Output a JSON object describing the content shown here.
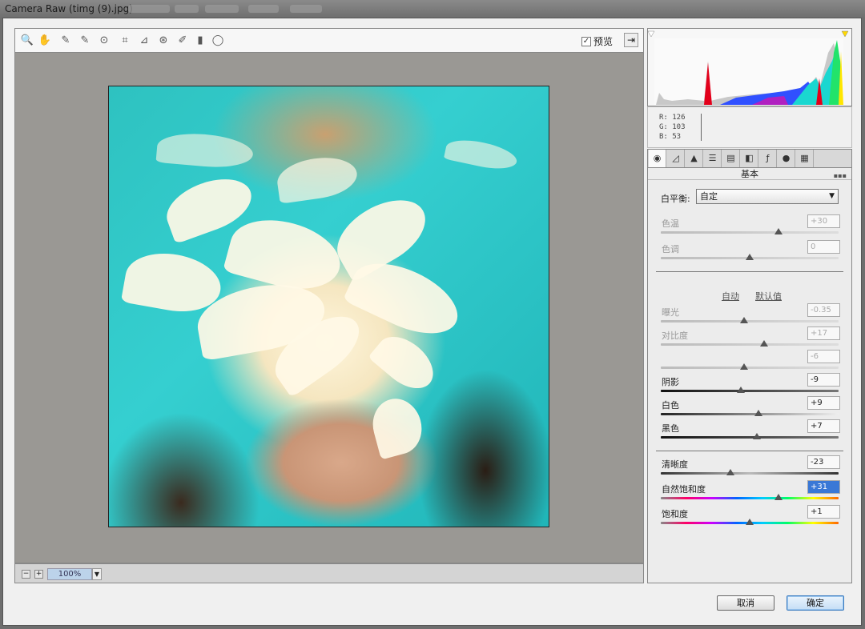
{
  "window": {
    "title": "Camera Raw (timg (9).jpg)"
  },
  "toolbar": {
    "tools": [
      {
        "name": "zoom-tool-icon",
        "glyph": "🔍"
      },
      {
        "name": "hand-tool-icon",
        "glyph": "✋"
      },
      {
        "name": "white-balance-tool-icon",
        "glyph": "✎"
      },
      {
        "name": "color-sampler-tool-icon",
        "glyph": "✎"
      },
      {
        "name": "targeted-adjustment-tool-icon",
        "glyph": "⊙"
      },
      {
        "name": "crop-tool-icon",
        "glyph": "⌗"
      },
      {
        "name": "straighten-tool-icon",
        "glyph": "⊿"
      },
      {
        "name": "spot-removal-tool-icon",
        "glyph": "⊛"
      },
      {
        "name": "adjustment-brush-icon",
        "glyph": "✐"
      },
      {
        "name": "graduated-filter-icon",
        "glyph": "▮"
      },
      {
        "name": "radial-filter-icon",
        "glyph": "◯"
      }
    ],
    "preview_label": "预览",
    "preview_checked": "✓"
  },
  "status": {
    "zoom": "100%"
  },
  "readout": {
    "r": "R:  126",
    "g": "G:  103",
    "b": "B:   53"
  },
  "panel": {
    "title": "基本",
    "white_balance_label": "白平衡:",
    "white_balance_value": "自定",
    "auto_label": "自动",
    "default_label": "默认值",
    "sliders": {
      "temp": {
        "label": "色温",
        "value": "+30",
        "pos": 0.66
      },
      "tint": {
        "label": "色调",
        "value": "0",
        "pos": 0.5
      },
      "exposure": {
        "label": "曝光",
        "value": "-0.35",
        "pos": 0.47
      },
      "contrast": {
        "label": "对比度",
        "value": "+17",
        "pos": 0.58
      },
      "highlights": {
        "label": "",
        "value": "-6",
        "pos": 0.47
      },
      "shadows": {
        "label": "阴影",
        "value": "-9",
        "pos": 0.45
      },
      "whites": {
        "label": "白色",
        "value": "+9",
        "pos": 0.55
      },
      "blacks": {
        "label": "黑色",
        "value": "+7",
        "pos": 0.54
      },
      "clarity": {
        "label": "清晰度",
        "value": "-23",
        "pos": 0.39
      },
      "vibrance": {
        "label": "自然饱和度",
        "value": "+31",
        "pos": 0.66
      },
      "saturation": {
        "label": "饱和度",
        "value": "+1",
        "pos": 0.5
      }
    }
  },
  "buttons": {
    "cancel": "取消",
    "ok": "确定"
  },
  "colors": {
    "accent": "#3b7bbf",
    "water": "#2ec2c0"
  }
}
